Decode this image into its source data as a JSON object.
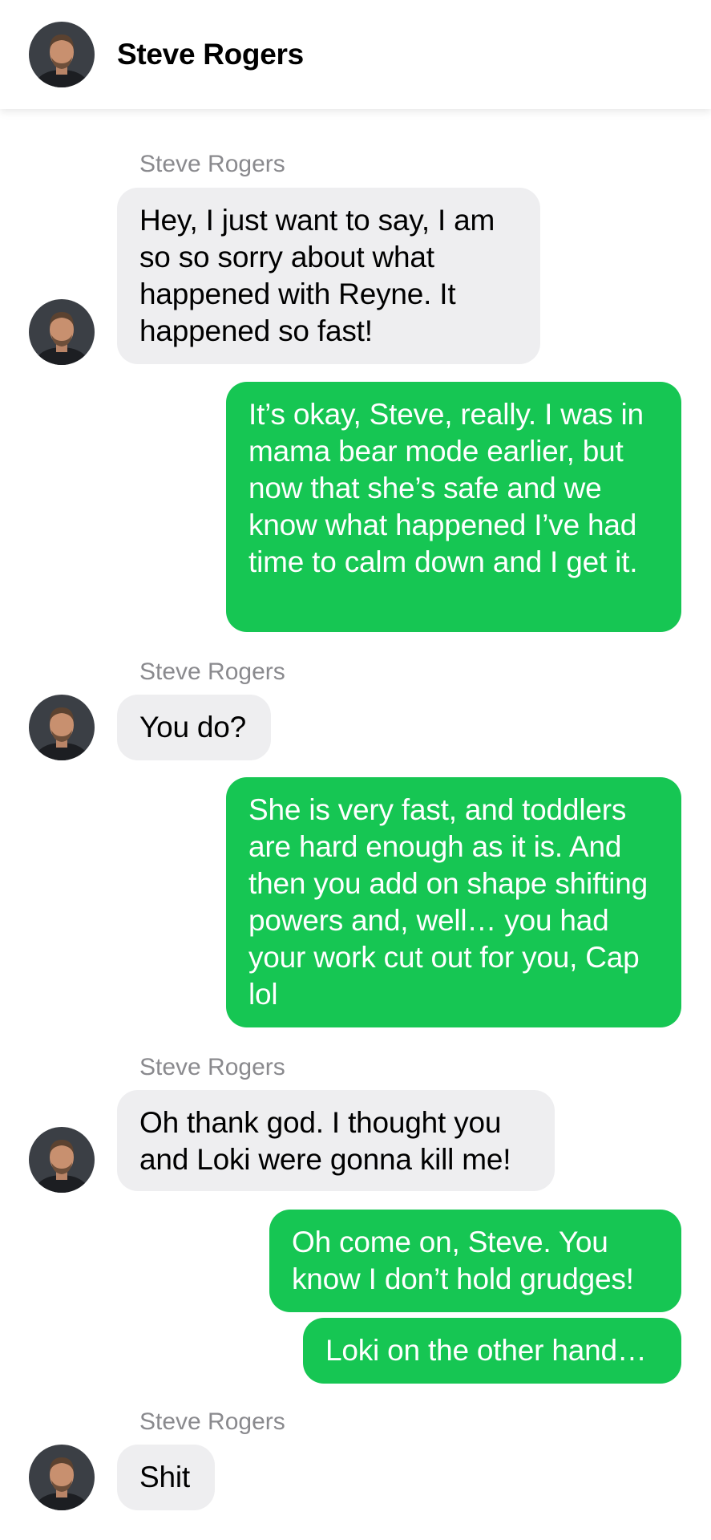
{
  "header": {
    "contact_name": "Steve Rogers",
    "avatar_icon": "contact-avatar-icon"
  },
  "colors": {
    "incoming_bubble": "#eeeef0",
    "outgoing_bubble": "#16c653",
    "sender_label": "#8a8a8e"
  },
  "messages": [
    {
      "from": "contact",
      "sender": "Steve Rogers",
      "text": "Hey, I just want to say, I am so so sorry about what happened with Reyne. It happened so fast!"
    },
    {
      "from": "me",
      "text": "It’s okay, Steve, really. I was in mama bear mode earlier, but now that she’s safe and we know what happened I’ve had time to calm down and I get it."
    },
    {
      "from": "contact",
      "sender": "Steve Rogers",
      "text": "You do?"
    },
    {
      "from": "me",
      "text": "She is very fast, and toddlers are hard enough as it is. And then you add on shape shifting powers and, well… you had your work cut out for you, Cap lol"
    },
    {
      "from": "contact",
      "sender": "Steve Rogers",
      "text": "Oh thank god. I thought you and Loki were gonna kill me!"
    },
    {
      "from": "me",
      "text": "Oh come on, Steve. You know I don’t hold grudges!"
    },
    {
      "from": "me",
      "text": "Loki on the other hand…"
    },
    {
      "from": "contact",
      "sender": "Steve Rogers",
      "text": "Shit"
    }
  ]
}
